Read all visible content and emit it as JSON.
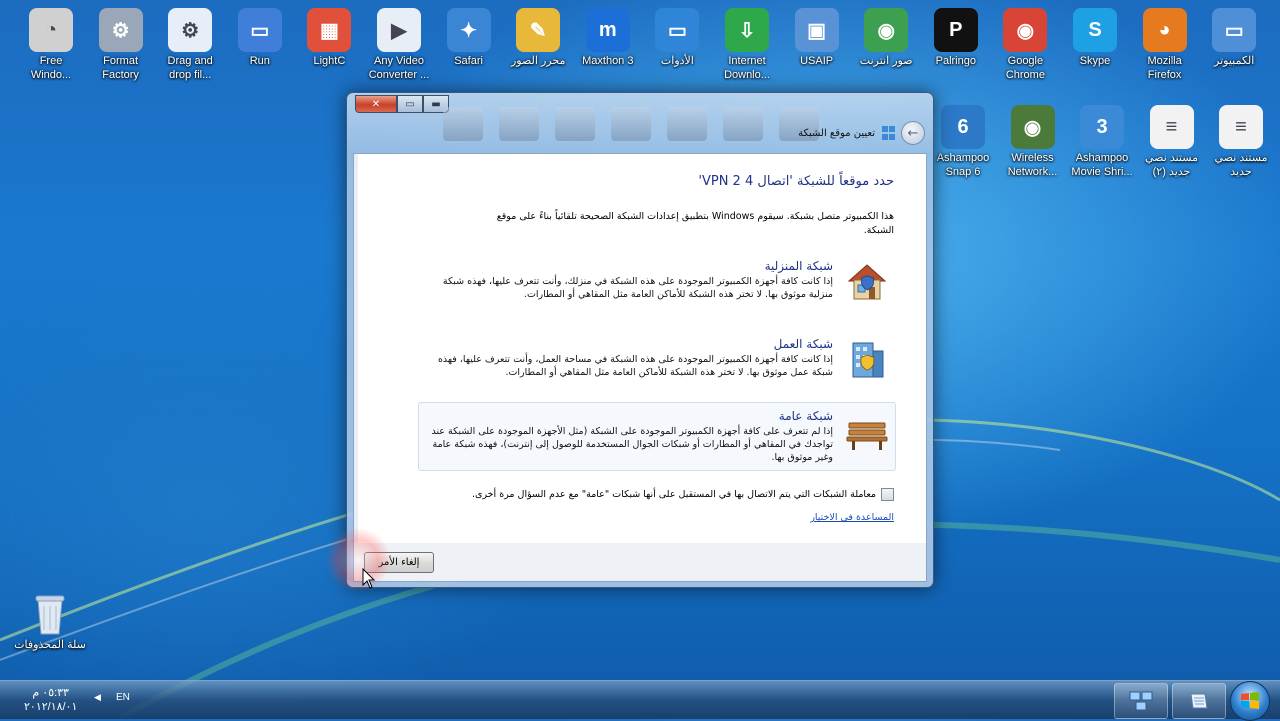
{
  "desktop": {
    "top_row": [
      {
        "label": "Free\nWindo...",
        "icon": "speedometer-icon",
        "color": "#d0d0d0",
        "glyph": "◔"
      },
      {
        "label": "Format\nFactory",
        "icon": "format-factory-icon",
        "color": "#9aa7b8",
        "glyph": "⚙"
      },
      {
        "label": "Drag and\ndrop fil...",
        "icon": "drag-drop-icon",
        "color": "#e6eef7",
        "glyph": "⚙"
      },
      {
        "label": "Run",
        "icon": "run-icon",
        "color": "#3f7fd9",
        "glyph": "▭"
      },
      {
        "label": "LightC",
        "icon": "lightc-icon",
        "color": "#e0503a",
        "glyph": "▦"
      },
      {
        "label": "Any Video\nConverter ...",
        "icon": "video-converter-icon",
        "color": "#e8eef5",
        "glyph": "▶"
      },
      {
        "label": "Safari",
        "icon": "safari-icon",
        "color": "#3b86d4",
        "glyph": "✦"
      },
      {
        "label": "محرر الصور",
        "icon": "paint-icon",
        "color": "#e8b83a",
        "glyph": "✎"
      },
      {
        "label": "Maxthon 3",
        "icon": "maxthon-icon",
        "color": "#1c6fd6",
        "glyph": "m"
      },
      {
        "label": "الأدوات",
        "icon": "tools-icon",
        "color": "#2f86d8",
        "glyph": "▭"
      },
      {
        "label": "Internet\nDownlo...",
        "icon": "download-manager-icon",
        "color": "#2ea84a",
        "glyph": "⇩"
      },
      {
        "label": "USAIP",
        "icon": "network-icon",
        "color": "#5a92d6",
        "glyph": "▣"
      },
      {
        "label": "صور انترنت",
        "icon": "globe-icon",
        "color": "#3ca050",
        "glyph": "◉"
      },
      {
        "label": "Palringo",
        "icon": "palringo-icon",
        "color": "#111111",
        "glyph": "P"
      },
      {
        "label": "Google\nChrome",
        "icon": "chrome-icon",
        "color": "#d84436",
        "glyph": "◉"
      },
      {
        "label": "Skype",
        "icon": "skype-icon",
        "color": "#1ea0e4",
        "glyph": "S"
      },
      {
        "label": "Mozilla\nFirefox",
        "icon": "firefox-icon",
        "color": "#e57a1e",
        "glyph": "◕"
      },
      {
        "label": "الكمبيوتر",
        "icon": "computer-icon",
        "color": "#4f8fd8",
        "glyph": "▭"
      }
    ],
    "second_row": [
      {
        "label": "Ashampoo\nSnap 6",
        "icon": "camera-icon",
        "color": "#2c79c8",
        "glyph": "6"
      },
      {
        "label": "Wireless\nNetwork...",
        "icon": "eye-icon",
        "color": "#4b7a3a",
        "glyph": "◉"
      },
      {
        "label": "Ashampoo\nMovie Shri...",
        "icon": "film-icon",
        "color": "#3a8ad8",
        "glyph": "3"
      },
      {
        "label": "مستند نصي\nجديد (٢)",
        "icon": "text-document-icon",
        "color": "#f2f2f2",
        "glyph": "≡"
      },
      {
        "label": "مستند نصي\nجديد",
        "icon": "text-document-icon",
        "color": "#f2f2f2",
        "glyph": "≡"
      }
    ],
    "recycle_bin": {
      "label": "سلة المحذوفات",
      "icon": "recycle-bin-icon"
    }
  },
  "dialog": {
    "window_title": "تعيين موقع الشبكة",
    "heading": "حدد موقعاً للشبكة 'اتصال 4  VPN 2'",
    "intro": "هذا الكمبيوتر متصل بشبكة. سيقوم Windows بتطبيق إعدادات الشبكة الصحيحة تلقائياً بناءً على موقع الشبكة.",
    "options": [
      {
        "title": "شبكة المنزلية",
        "desc": "إذا كانت كافة أجهزة الكمبيوتر الموجودة على هذه الشبكة في منزلك، وأنت تتعرف عليها، فهذه شبكة منزلية موثوق بها.  لا تختر هذه الشبكة للأماكن العامة مثل المقاهي أو المطارات.",
        "icon": "home-network-icon"
      },
      {
        "title": "شبكة العمل",
        "desc": "إذا كانت كافة أجهزة الكمبيوتر الموجودة على هذه الشبكة في مساحة العمل، وأنت تتعرف عليها، فهذه شبكة عمل موثوق بها.  لا تختر هذه الشبكة للأماكن العامة مثل المقاهي أو المطارات.",
        "icon": "work-network-icon"
      },
      {
        "title": "شبكة عامة",
        "desc": "إذا لم تتعرف على كافة أجهزة الكمبيوتر الموجودة على الشبكة (مثل الأجهزة الموجودة على الشبكة عند تواجدك في المقاهي أو المطارات أو شبكات الجوال المستخدمة للوصول إلى إنترنت)، فهذه شبكة عامة وغير موثوق بها.",
        "icon": "public-network-icon"
      }
    ],
    "checkbox_label": "معاملة الشبكات التي يتم الاتصال بها في المستقبل على أنها شبكات \"عامة\" مع عدم السؤال مرة أخرى.",
    "help_link": "المساعدة في الاختيار",
    "cancel_button": "إلغاء الأمر",
    "close_glyph": "✕",
    "max_glyph": "▭",
    "min_glyph": "▬",
    "back_glyph": "←"
  },
  "taskbar": {
    "time": "٠٥:٣٣ م",
    "date": "٢٠١٢/١٨/٠١",
    "language": "EN",
    "tray_chevron": "◀"
  },
  "colors": {
    "link": "#1a4db3",
    "heading": "#1e3287"
  }
}
